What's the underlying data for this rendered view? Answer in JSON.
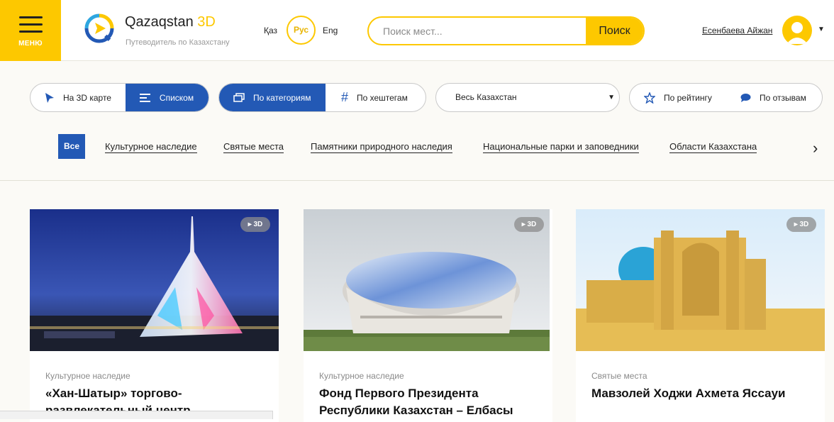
{
  "header": {
    "menu_label": "МЕНЮ",
    "logo_name_main": "Qazaqstan",
    "logo_name_accent": "3D",
    "logo_subtitle": "Путеводитель по Казахстану",
    "languages": [
      "Қаз",
      "Рус",
      "Eng"
    ],
    "active_language": "Рус",
    "search": {
      "placeholder": "Поиск мест...",
      "button_label": "Поиск"
    },
    "user_name": "Есенбаева Айжан"
  },
  "view_toggle": {
    "map_label": "На 3D карте",
    "list_label": "Списком",
    "active": "Списком"
  },
  "group_toggle": {
    "categories_label": "По категориям",
    "hashtags_label": "По хештегам",
    "active": "По категориям"
  },
  "region_select": {
    "value": "Весь Казахстан"
  },
  "sort_toggle": {
    "rating_label": "По рейтингу",
    "reviews_label": "По отзывам"
  },
  "categories": {
    "all_label": "Все",
    "items": [
      "Культурное наследие",
      "Святые места",
      "Памятники природного наследия",
      "Национальные парки и заповедники",
      "Области Казахстана"
    ]
  },
  "cards": [
    {
      "badge": "3D",
      "category": "Культурное наследие",
      "title": "«Хан-Шатыр» торгово-развлекательный центр"
    },
    {
      "badge": "3D",
      "category": "Культурное наследие",
      "title": "Фонд Первого Президента Республики Казахстан – Елбасы"
    },
    {
      "badge": "3D",
      "category": "Святые места",
      "title": "Мавзолей Ходжи Ахмета Яссауи"
    }
  ],
  "colors": {
    "accent_yellow": "#fdc800",
    "primary_blue": "#2359b5"
  }
}
